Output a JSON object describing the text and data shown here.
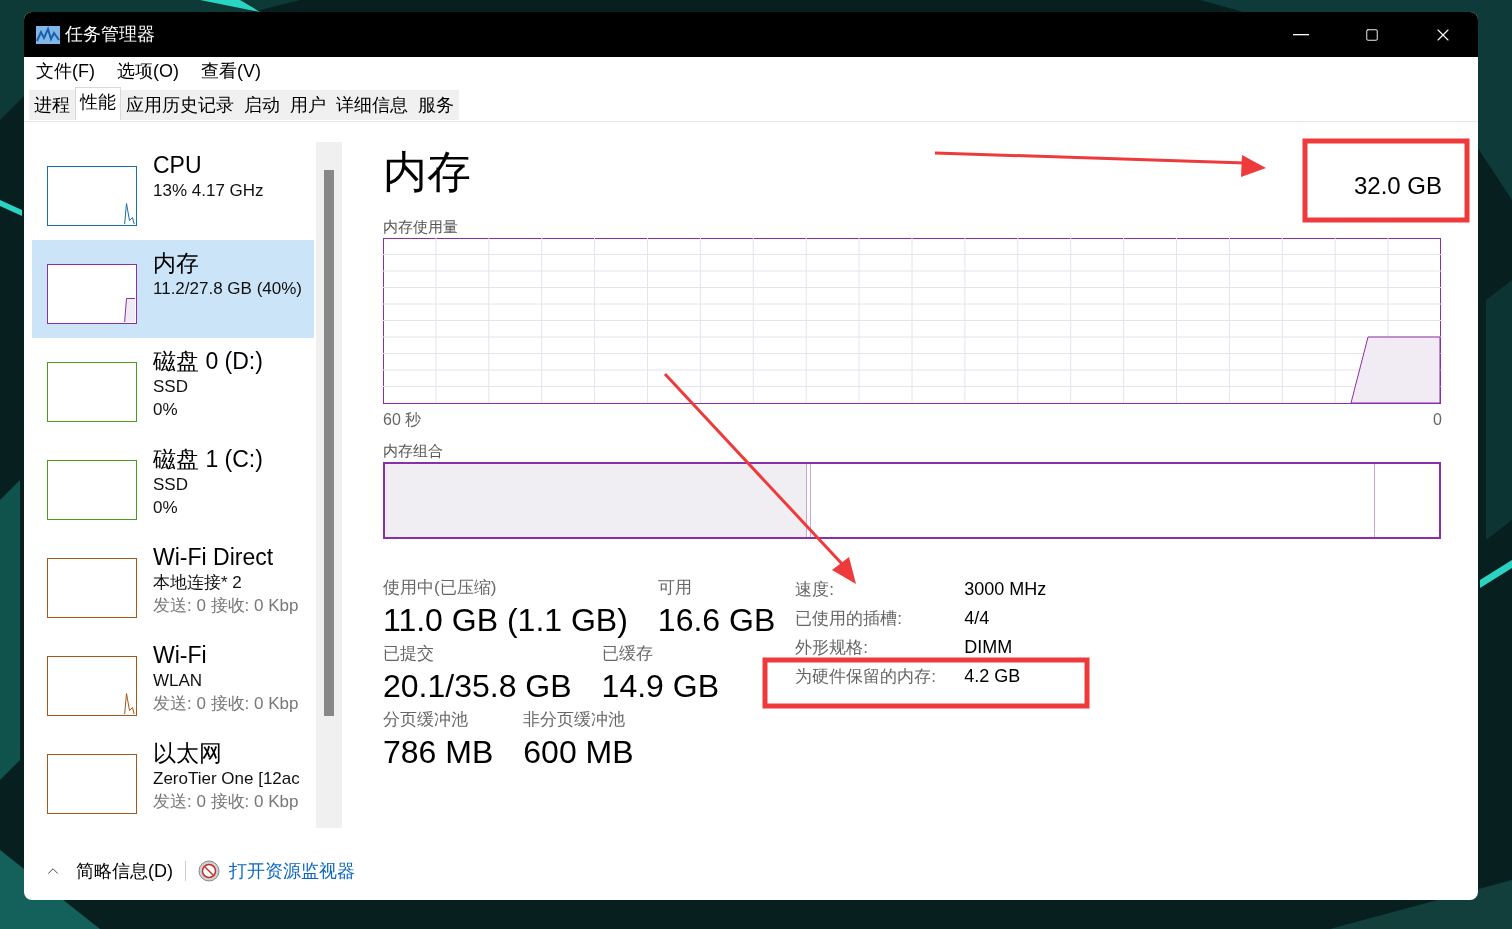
{
  "window": {
    "title": "任务管理器"
  },
  "menu": [
    "文件(F)",
    "选项(O)",
    "查看(V)"
  ],
  "tabs": [
    {
      "label": "进程",
      "selected": false
    },
    {
      "label": "性能",
      "selected": true
    },
    {
      "label": "应用历史记录",
      "selected": false
    },
    {
      "label": "启动",
      "selected": false
    },
    {
      "label": "用户",
      "selected": false
    },
    {
      "label": "详细信息",
      "selected": false
    },
    {
      "label": "服务",
      "selected": false
    }
  ],
  "sidebar": {
    "items": [
      {
        "name": "CPU",
        "subtitle": "13%  4.17 GHz",
        "color": "#1b6fa8",
        "kind": "spike",
        "selected": false
      },
      {
        "name": "内存",
        "subtitle": "11.2/27.8 GB (40%)",
        "color": "#8b2fa8",
        "kind": "step",
        "selected": true
      },
      {
        "name": "磁盘 0 (D:)",
        "subtitle": "SSD",
        "usage": "0%",
        "color": "#4d9a1c",
        "kind": "flat",
        "selected": false
      },
      {
        "name": "磁盘 1 (C:)",
        "subtitle": "SSD",
        "usage": "0%",
        "color": "#4d9a1c",
        "kind": "flat",
        "selected": false
      },
      {
        "name": "Wi-Fi Direct",
        "subtitle": "本地连接* 2",
        "traffic": "发送: 0  接收: 0 Kbp",
        "color": "#a7571a",
        "kind": "flat",
        "selected": false
      },
      {
        "name": "Wi-Fi",
        "subtitle": "WLAN",
        "traffic": "发送: 0  接收: 0 Kbp",
        "color": "#a7571a",
        "kind": "spike",
        "selected": false
      },
      {
        "name": "以太网",
        "subtitle": "ZeroTier One [12ac",
        "traffic": "发送: 0  接收: 0 Kbp",
        "color": "#a7571a",
        "kind": "flat",
        "selected": false
      }
    ]
  },
  "panel": {
    "title": "内存",
    "capacity": "32.0 GB",
    "usage_graph": {
      "label": "内存使用量",
      "x_start": "60 秒",
      "x_end": "0"
    },
    "composition": {
      "label": "内存组合",
      "level": 0.4
    },
    "stats": [
      [
        {
          "label": "使用中(已压缩)",
          "value": "11.0 GB (1.1 GB)"
        },
        {
          "label": "可用",
          "value": "16.6 GB"
        }
      ],
      [
        {
          "label": "已提交",
          "value": "20.1/35.8 GB"
        },
        {
          "label": "已缓存",
          "value": "14.9 GB"
        }
      ],
      [
        {
          "label": "分页缓冲池",
          "value": "786 MB"
        },
        {
          "label": "非分页缓冲池",
          "value": "600 MB"
        }
      ]
    ],
    "details": [
      {
        "label": "速度:",
        "value": "3000 MHz"
      },
      {
        "label": "已使用的插槽:",
        "value": "4/4"
      },
      {
        "label": "外形规格:",
        "value": "DIMM"
      },
      {
        "label": "为硬件保留的内存:",
        "value": "4.2 GB"
      }
    ]
  },
  "footer": {
    "fewer_details": "简略信息(D)",
    "resource_monitor": "打开资源监视器"
  }
}
